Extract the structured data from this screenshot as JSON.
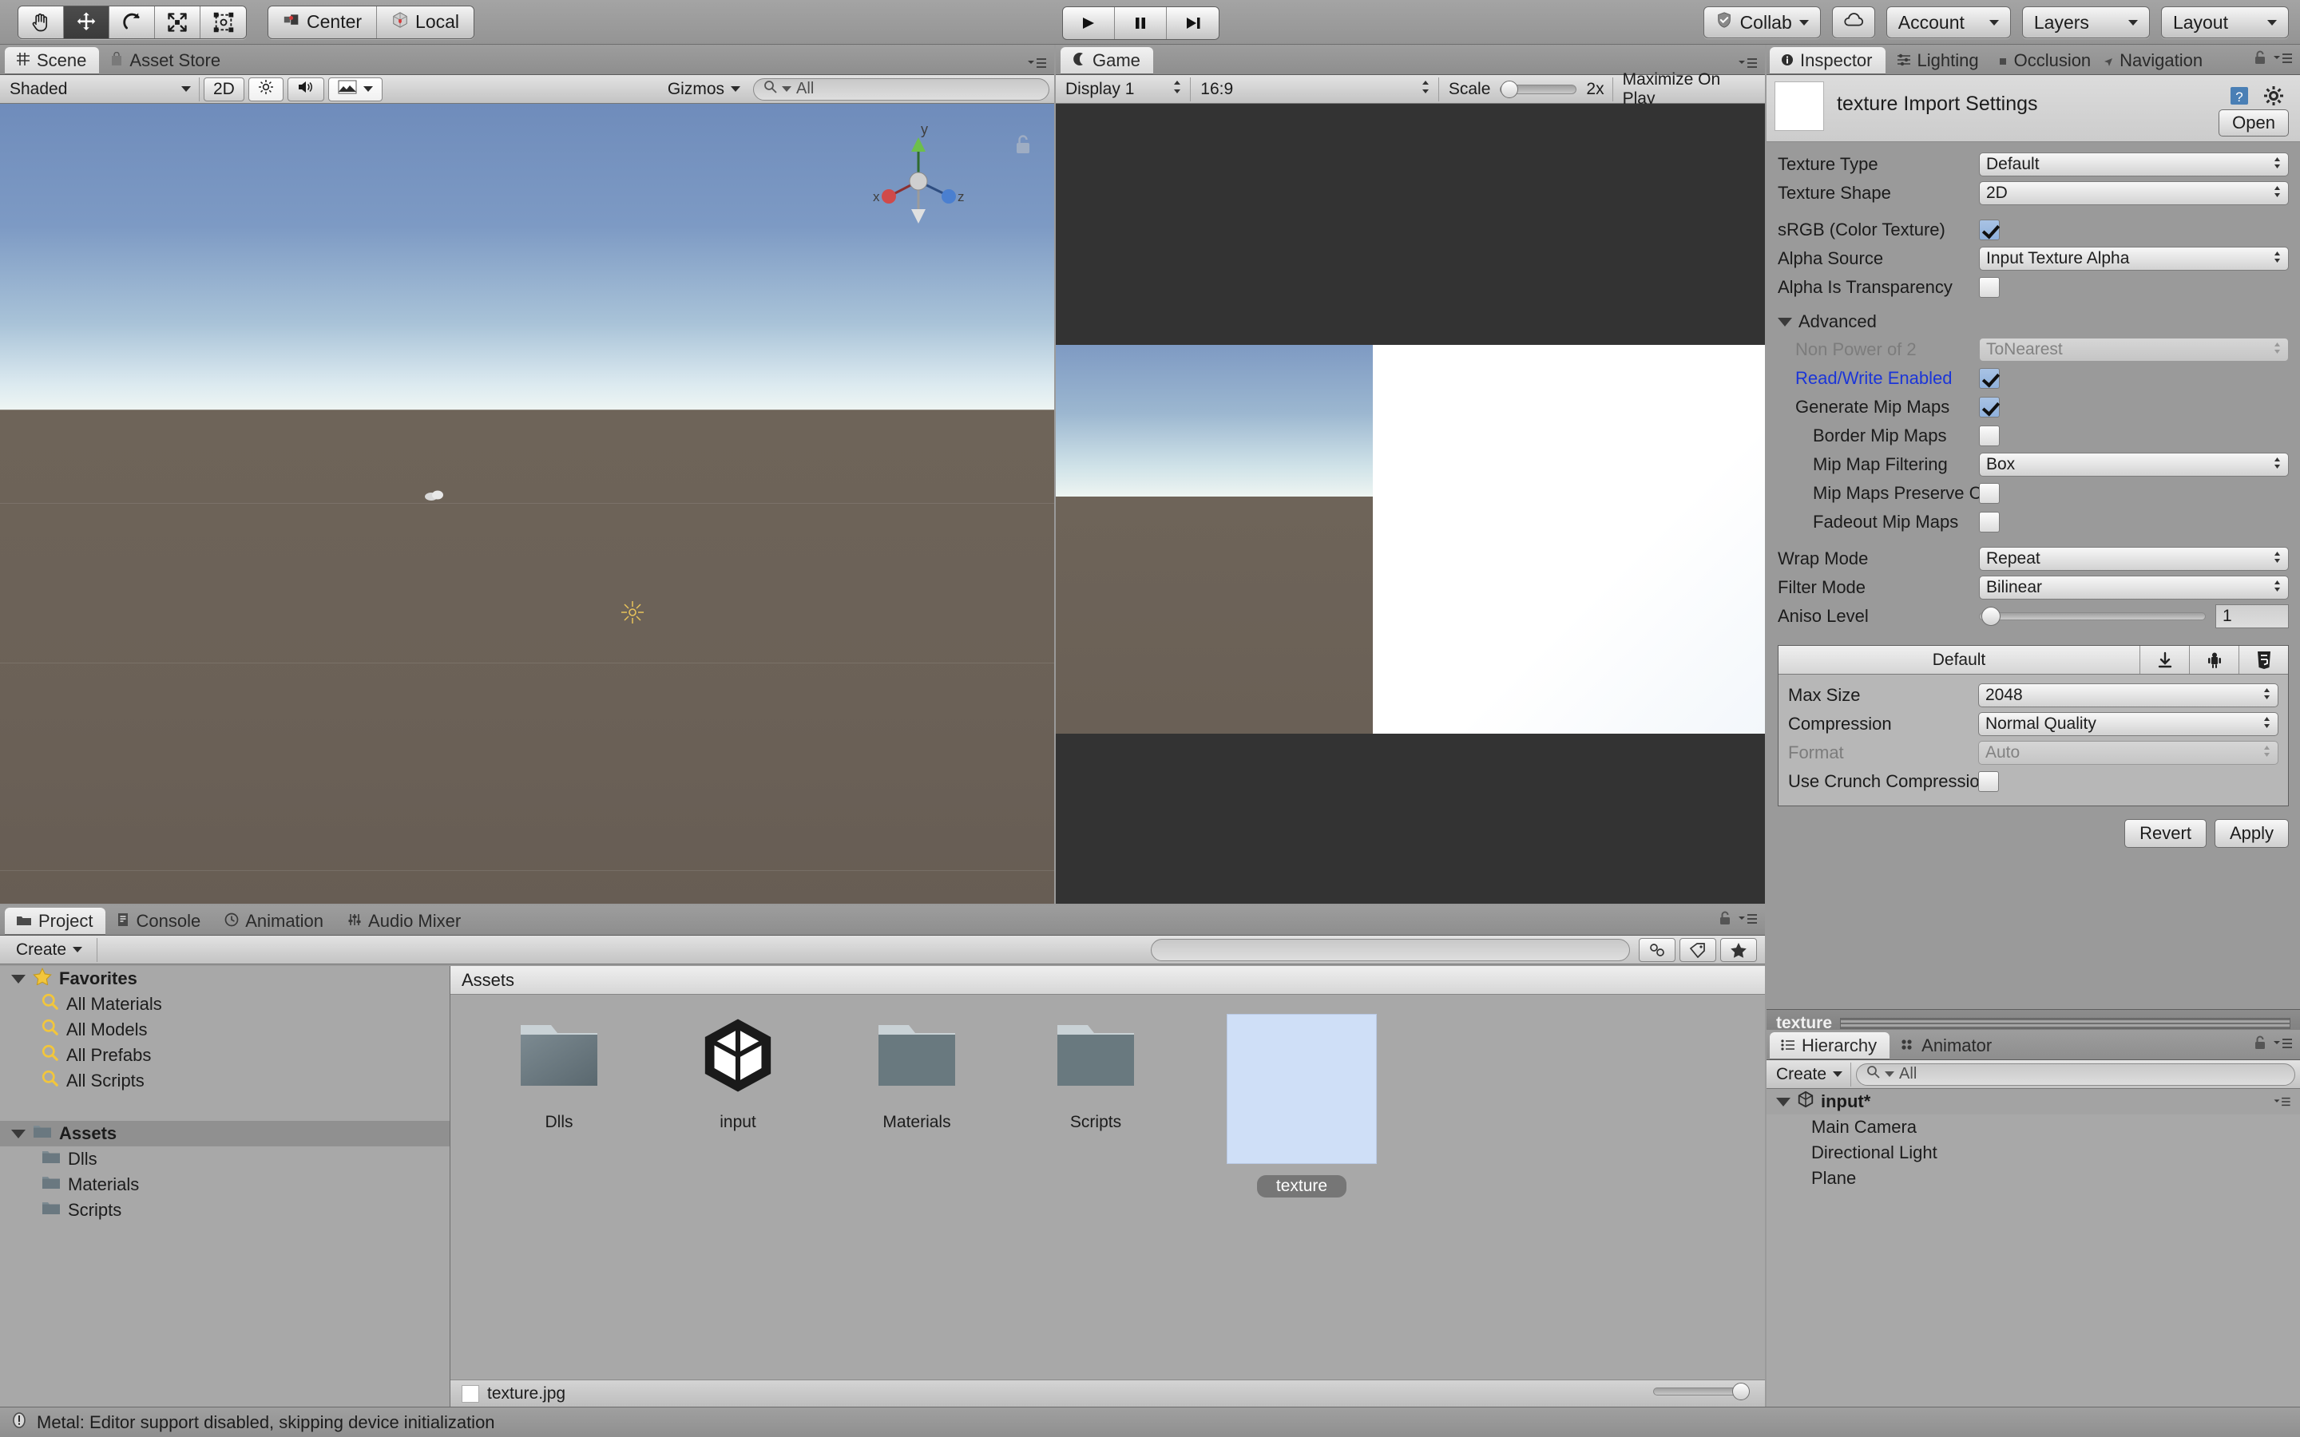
{
  "toolbar": {
    "tools": [
      {
        "name": "hand-tool",
        "icon": "hand",
        "selected": false
      },
      {
        "name": "move-tool",
        "icon": "move",
        "selected": true
      },
      {
        "name": "rotate-tool",
        "icon": "rotate",
        "selected": false
      },
      {
        "name": "scale-tool",
        "icon": "scale",
        "selected": false
      },
      {
        "name": "rect-tool",
        "icon": "rect",
        "selected": false
      }
    ],
    "pivot_label": "Center",
    "rotation_label": "Local",
    "play_label": "play-icon",
    "pause_label": "pause-icon",
    "step_label": "step-icon",
    "collab_label": "Collab",
    "cloud_label": "cloud-icon",
    "account_label": "Account",
    "layers_label": "Layers",
    "layout_label": "Layout"
  },
  "scene": {
    "tabs": [
      {
        "label": "Scene",
        "icon": "grid-icon",
        "active": true
      },
      {
        "label": "Asset Store",
        "icon": "bag-icon",
        "active": false
      }
    ],
    "draw_mode": "Shaded",
    "mode_2d": "2D",
    "lighting_icon": "sun-icon",
    "audio_icon": "speaker-icon",
    "effects_icon": "image-icon",
    "gizmos_label": "Gizmos",
    "search_placeholder": "All",
    "axis_labels": {
      "x": "x",
      "y": "y",
      "z": "z"
    }
  },
  "game": {
    "tabs": [
      {
        "label": "Game",
        "icon": "gamepad-icon",
        "active": true
      }
    ],
    "display": "Display 1",
    "aspect": "16:9",
    "scale_label": "Scale",
    "scale_value": "2x",
    "maximize_label": "Maximize On Play"
  },
  "inspector": {
    "tabs": [
      {
        "label": "Inspector",
        "icon": "info-icon",
        "active": true
      },
      {
        "label": "Lighting",
        "icon": "lighting-icon",
        "active": false
      },
      {
        "label": "Occlusion",
        "icon": "occlusion-icon",
        "active": false
      },
      {
        "label": "Navigation",
        "icon": "navigation-icon",
        "active": false
      }
    ],
    "title": "texture Import Settings",
    "open_label": "Open",
    "help_icon": "help-book-icon",
    "gear_icon": "gear-icon",
    "fields": [
      {
        "label": "Texture Type",
        "type": "dropdown",
        "value": "Default",
        "indent": 0,
        "disabled": false
      },
      {
        "label": "Texture Shape",
        "type": "dropdown",
        "value": "2D",
        "indent": 0,
        "disabled": false
      },
      {
        "label": "sRGB (Color Texture)",
        "type": "checkbox",
        "value": true,
        "indent": 0,
        "disabled": false
      },
      {
        "label": "Alpha Source",
        "type": "dropdown",
        "value": "Input Texture Alpha",
        "indent": 0,
        "disabled": false
      },
      {
        "label": "Alpha Is Transparency",
        "type": "checkbox",
        "value": false,
        "indent": 0,
        "disabled": false
      }
    ],
    "advanced_label": "Advanced",
    "advanced_fields": [
      {
        "label": "Non Power of 2",
        "type": "dropdown",
        "value": "ToNearest",
        "indent": 1,
        "disabled": true
      },
      {
        "label": "Read/Write Enabled",
        "type": "checkbox",
        "value": true,
        "indent": 1,
        "highlight": true
      },
      {
        "label": "Generate Mip Maps",
        "type": "checkbox",
        "value": true,
        "indent": 1,
        "disabled": false
      },
      {
        "label": "Border Mip Maps",
        "type": "checkbox",
        "value": false,
        "indent": 2,
        "disabled": false
      },
      {
        "label": "Mip Map Filtering",
        "type": "dropdown",
        "value": "Box",
        "indent": 2,
        "disabled": false
      },
      {
        "label": "Mip Maps Preserve Coverage",
        "type": "checkbox",
        "value": false,
        "indent": 2,
        "disabled": false
      },
      {
        "label": "Fadeout Mip Maps",
        "type": "checkbox",
        "value": false,
        "indent": 2,
        "disabled": false
      }
    ],
    "filter_fields": [
      {
        "label": "Wrap Mode",
        "type": "dropdown",
        "value": "Repeat",
        "indent": 0,
        "disabled": false
      },
      {
        "label": "Filter Mode",
        "type": "dropdown",
        "value": "Bilinear",
        "indent": 0,
        "disabled": false
      }
    ],
    "aniso_label": "Aniso Level",
    "aniso_value": "1",
    "platform_tab": "Default",
    "platform_icons": [
      "standalone-icon",
      "android-icon",
      "webgl-icon"
    ],
    "platform_fields": [
      {
        "label": "Max Size",
        "type": "dropdown",
        "value": "2048",
        "disabled": false
      },
      {
        "label": "Compression",
        "type": "dropdown",
        "value": "Normal Quality",
        "disabled": false
      },
      {
        "label": "Format",
        "type": "dropdown",
        "value": "Auto",
        "disabled": true
      },
      {
        "label": "Use Crunch Compression",
        "type": "checkbox",
        "value": false,
        "disabled": false
      }
    ],
    "revert_label": "Revert",
    "apply_label": "Apply",
    "preview_name": "texture"
  },
  "hierarchy": {
    "tabs": [
      {
        "label": "Hierarchy",
        "icon": "list-icon",
        "active": true
      },
      {
        "label": "Animator",
        "icon": "animator-icon",
        "active": false
      }
    ],
    "create_label": "Create",
    "search_placeholder": "All",
    "root": "input*",
    "items": [
      "Main Camera",
      "Directional Light",
      "Plane"
    ]
  },
  "project": {
    "tabs": [
      {
        "label": "Project",
        "icon": "folder-icon",
        "active": true
      },
      {
        "label": "Console",
        "icon": "console-icon",
        "active": false
      },
      {
        "label": "Animation",
        "icon": "clock-icon",
        "active": false
      },
      {
        "label": "Audio Mixer",
        "icon": "mixer-icon",
        "active": false
      }
    ],
    "create_label": "Create",
    "search_placeholder": "",
    "favorites_label": "Favorites",
    "favorites": [
      "All Materials",
      "All Models",
      "All Prefabs",
      "All Scripts"
    ],
    "assets_label": "Assets",
    "folders": [
      "Dlls",
      "Materials",
      "Scripts"
    ],
    "content_header": "Assets",
    "grid_items": [
      {
        "label": "Dlls",
        "kind": "folder",
        "selected": false
      },
      {
        "label": "input",
        "kind": "unity-scene",
        "selected": false
      },
      {
        "label": "Materials",
        "kind": "folder",
        "selected": false
      },
      {
        "label": "Scripts",
        "kind": "folder",
        "selected": false
      },
      {
        "label": "texture",
        "kind": "texture",
        "selected": true
      }
    ],
    "footer_file": "texture.jpg"
  },
  "statusbar": {
    "message": "Metal: Editor support disabled, skipping device initialization",
    "icon": "warning-icon"
  },
  "colors": {
    "chrome": "#9a9a9a",
    "panel": "#a8a8a8",
    "selection": "#767676",
    "link_blue": "#1b35d8",
    "checkbox_on": "#8fb1dc"
  }
}
